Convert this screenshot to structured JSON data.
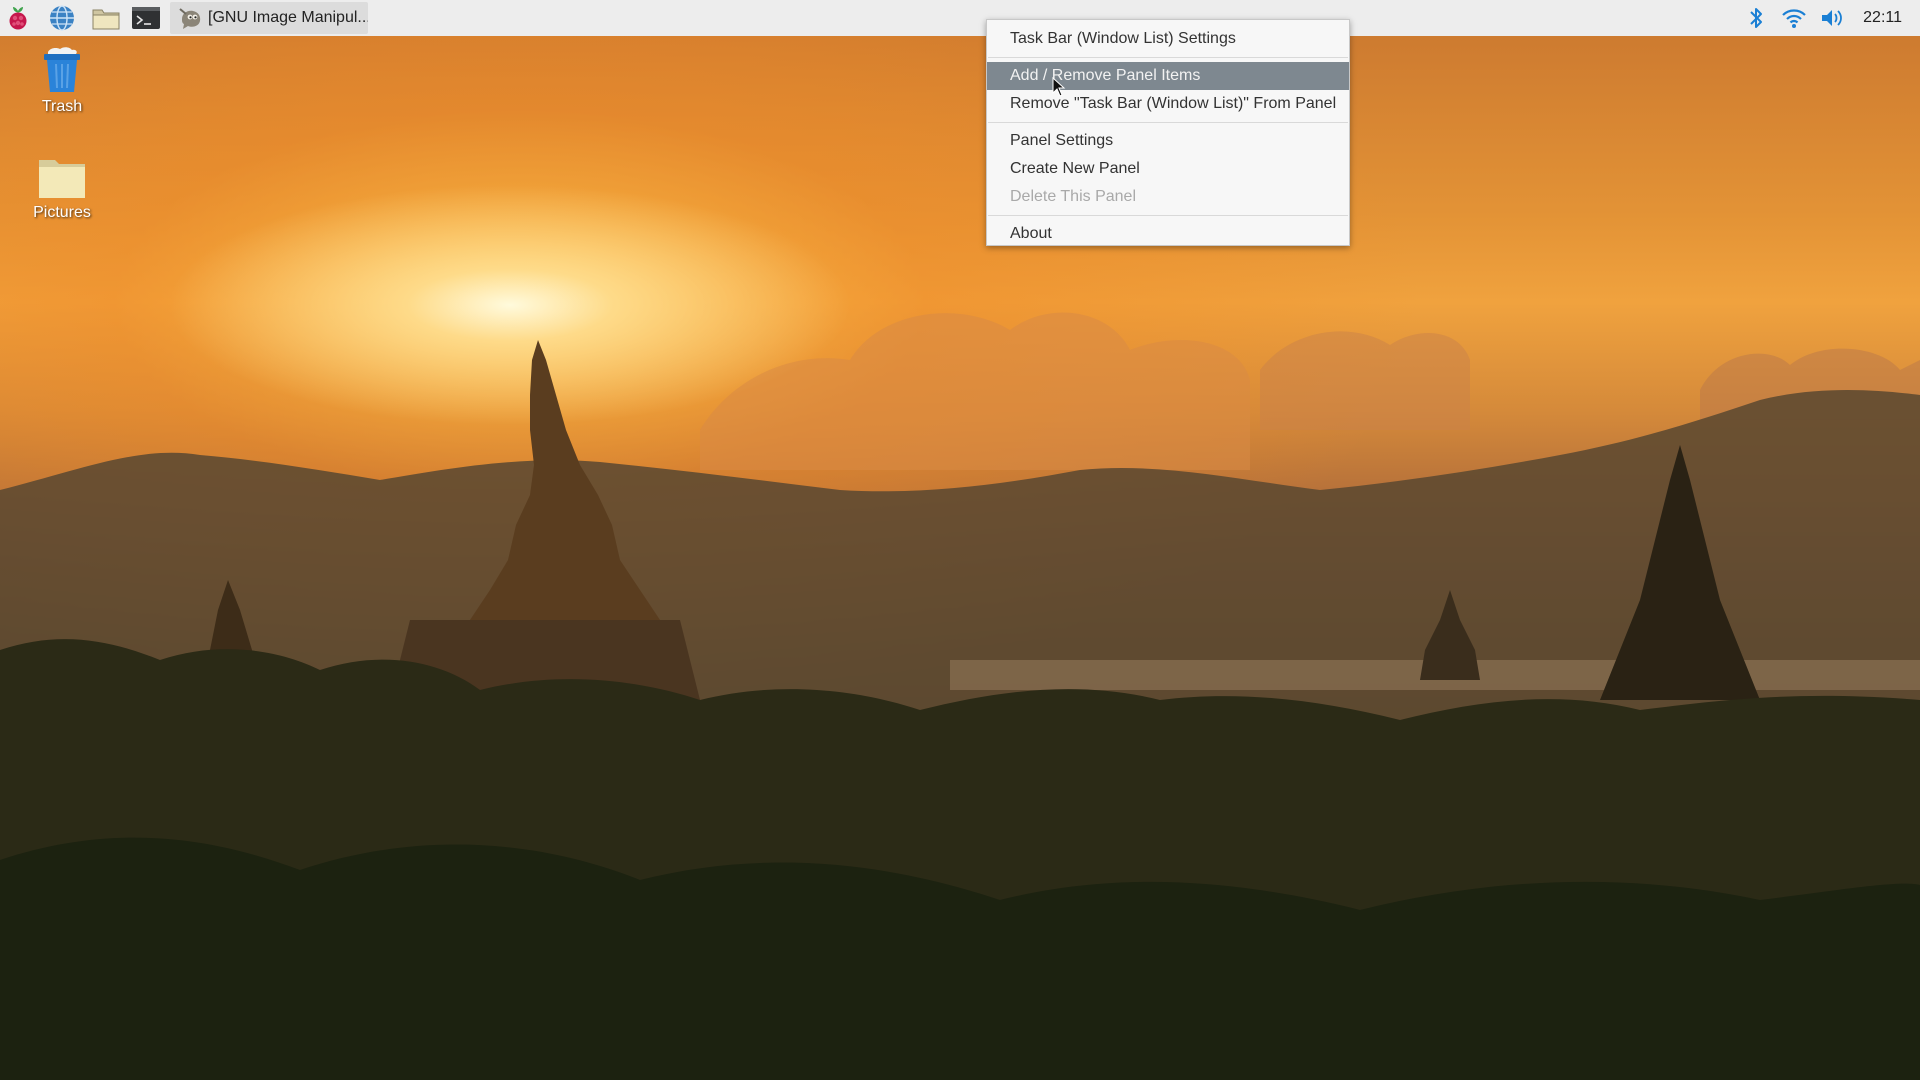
{
  "panel": {
    "launchers": [
      {
        "name": "raspberry-menu-icon"
      },
      {
        "name": "web-browser-icon"
      },
      {
        "name": "file-manager-icon"
      },
      {
        "name": "terminal-icon"
      }
    ],
    "task": {
      "label": "[GNU Image Manipul...",
      "icon": "gimp-icon"
    },
    "tray": {
      "icons": [
        "bluetooth-icon",
        "wifi-icon",
        "volume-icon"
      ],
      "clock": "22:11"
    }
  },
  "desktop": {
    "icons": [
      {
        "label": "Trash",
        "icon": "trash-icon"
      },
      {
        "label": "Pictures",
        "icon": "folder-icon"
      }
    ]
  },
  "context_menu": {
    "items": [
      {
        "label": "Task Bar (Window List) Settings",
        "state": "normal"
      },
      {
        "label": "Add / Remove Panel Items",
        "state": "highlighted"
      },
      {
        "label": "Remove \"Task Bar (Window List)\" From Panel",
        "state": "normal"
      },
      {
        "label": "Panel Settings",
        "state": "normal"
      },
      {
        "label": "Create New Panel",
        "state": "normal"
      },
      {
        "label": "Delete This Panel",
        "state": "disabled"
      },
      {
        "label": "About",
        "state": "normal"
      }
    ]
  },
  "colors": {
    "panel_bg": "#ededed",
    "menu_bg": "#f7f7f7",
    "menu_highlight": "#7e8890",
    "tray_icon_blue": "#1a7fd4"
  }
}
